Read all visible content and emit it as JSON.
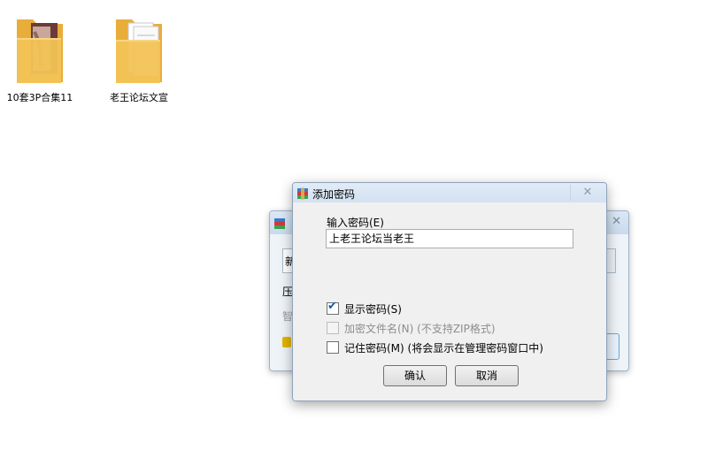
{
  "desktop": {
    "icons": [
      {
        "label": "10套3P合集11",
        "icon": "folder-icon"
      },
      {
        "label": "老王论坛文宣",
        "icon": "folder-icon"
      }
    ]
  },
  "background_window": {
    "fragments": [
      "新",
      "压",
      "智"
    ]
  },
  "dialog": {
    "title": "添加密码",
    "password_label": "输入密码(E)",
    "password_value": "上老王论坛当老王",
    "options": {
      "show_password": {
        "label": "显示密码(S)",
        "checked": true
      },
      "encrypt_filenames": {
        "label": "加密文件名(N) (不支持ZIP格式)",
        "checked": false,
        "disabled": true
      },
      "remember_password": {
        "label": "记住密码(M) (将会显示在管理密码窗口中)",
        "checked": false
      }
    },
    "buttons": {
      "ok": "确认",
      "cancel": "取消"
    }
  },
  "colors": {
    "folder": "#f3c356",
    "titlebar": "#dbe8f5",
    "check_accent": "#1d5aa0"
  }
}
